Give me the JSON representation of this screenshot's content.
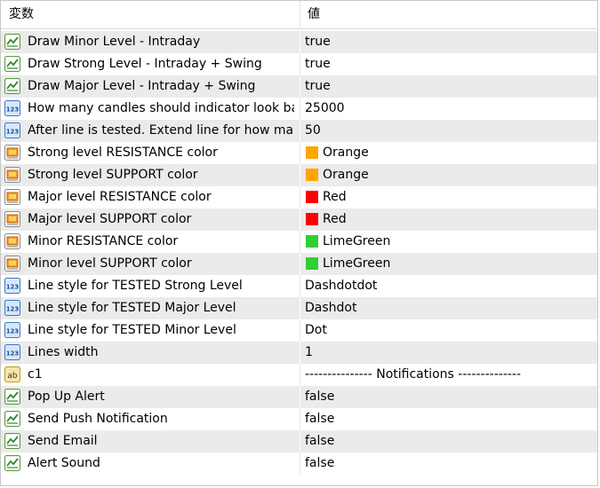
{
  "header": {
    "name_col": "変数",
    "value_col": "値"
  },
  "colors": {
    "row_alt": "#ebebeb",
    "orange": "#ffa500",
    "red": "#ff0000",
    "limegreen": "#32cd32"
  },
  "rows": [
    {
      "icon": "bool-chart-icon",
      "name": "Draw Minor Level - Intraday",
      "value": "true"
    },
    {
      "icon": "bool-chart-icon",
      "name": "Draw Strong Level - Intraday + Swing",
      "value": "true"
    },
    {
      "icon": "bool-chart-icon",
      "name": "Draw Major Level - Intraday + Swing",
      "value": "true"
    },
    {
      "icon": "number-123-icon",
      "name": "How many candles should indicator look ba...",
      "value": "25000"
    },
    {
      "icon": "number-123-icon",
      "name": "After line is tested. Extend line for how man...",
      "value": "50"
    },
    {
      "icon": "color-palette-icon",
      "name": "Strong level RESISTANCE color",
      "value": "Orange",
      "swatch": "#ffa500"
    },
    {
      "icon": "color-palette-icon",
      "name": "Strong level SUPPORT color",
      "value": "Orange",
      "swatch": "#ffa500"
    },
    {
      "icon": "color-palette-icon",
      "name": "Major level RESISTANCE color",
      "value": "Red",
      "swatch": "#ff0000"
    },
    {
      "icon": "color-palette-icon",
      "name": "Major level SUPPORT color",
      "value": "Red",
      "swatch": "#ff0000"
    },
    {
      "icon": "color-palette-icon",
      "name": "Minor RESISTANCE color",
      "value": "LimeGreen",
      "swatch": "#32cd32"
    },
    {
      "icon": "color-palette-icon",
      "name": "Minor level SUPPORT color",
      "value": "LimeGreen",
      "swatch": "#32cd32"
    },
    {
      "icon": "number-123-icon",
      "name": "Line style for TESTED Strong Level",
      "value": "Dashdotdot"
    },
    {
      "icon": "number-123-icon",
      "name": "Line style for TESTED Major Level",
      "value": "Dashdot"
    },
    {
      "icon": "number-123-icon",
      "name": "Line style for TESTED Minor Level",
      "value": "Dot"
    },
    {
      "icon": "number-123-icon",
      "name": "Lines width",
      "value": "1"
    },
    {
      "icon": "string-ab-icon",
      "name": "c1",
      "value": "--------------- Notifications --------------"
    },
    {
      "icon": "bool-chart-icon",
      "name": "Pop Up Alert",
      "value": "false"
    },
    {
      "icon": "bool-chart-icon",
      "name": "Send Push Notification",
      "value": "false"
    },
    {
      "icon": "bool-chart-icon",
      "name": "Send Email",
      "value": "false"
    },
    {
      "icon": "bool-chart-icon",
      "name": "Alert Sound",
      "value": "false"
    }
  ]
}
